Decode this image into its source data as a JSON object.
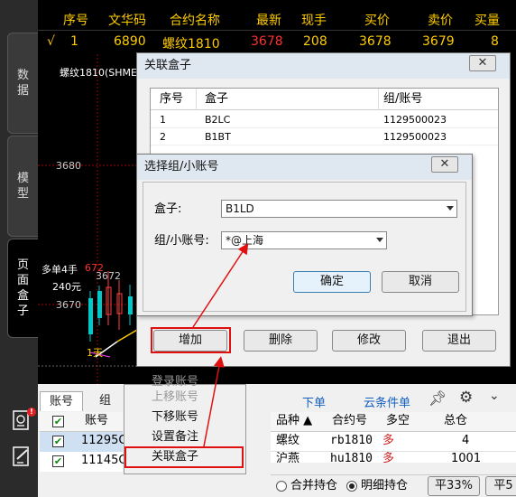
{
  "quote": {
    "headers": [
      "序号",
      "文华码",
      "合约名称",
      "最新",
      "现手",
      "买价",
      "卖价",
      "买量"
    ],
    "row": {
      "mark": "√",
      "index": "1",
      "code": "6890",
      "name": "螺纹1810",
      "last": "3678",
      "hand": "208",
      "bid": "3678",
      "ask": "3679",
      "bidvol": "8"
    }
  },
  "nav": {
    "tab1": [
      "数",
      "据"
    ],
    "tab2": [
      "模",
      "型"
    ],
    "tab3": [
      "页",
      "面",
      "盒",
      "子"
    ]
  },
  "chart": {
    "title": "螺纹1810(SHME",
    "price_3680": "3680",
    "price_3672": "3672",
    "price_3670": "3670",
    "signal": "多单4手",
    "signal_value": "672",
    "price_240": "240元",
    "day_label": "1天"
  },
  "bottom": {
    "tabs": [
      "账号",
      "组"
    ],
    "account_header": "账号",
    "accounts": [
      "11295C",
      "11145C"
    ],
    "toolbar": {
      "order": "下单",
      "cloud": "云条件单"
    },
    "positions_headers": [
      "品种 ▲",
      "合约号",
      "多空",
      "总仓"
    ],
    "positions": [
      {
        "product": "螺纹",
        "contract": "rb1810",
        "side": "多",
        "total": "4"
      },
      {
        "product": "沪燕",
        "contract": "hu1810",
        "side": "多",
        "total": "1001"
      }
    ],
    "radio_merge": "合并持仓",
    "radio_detail": "明细持仓",
    "btn_flat33": "平33%",
    "btn_flat5": "平5"
  },
  "ctxmenu": {
    "items": [
      "登录账号",
      "上移账号",
      "下移账号",
      "设置备注",
      "关联盒子"
    ]
  },
  "dlg_outer": {
    "title": "关联盒子",
    "close": "✕",
    "headers": [
      "序号",
      "盒子",
      "组/账号"
    ],
    "rows": [
      {
        "index": "1",
        "box": "B2LC",
        "account": "1129500023"
      },
      {
        "index": "2",
        "box": "B1BT",
        "account": "1129500023"
      }
    ],
    "btn_add": "增加",
    "btn_delete": "删除",
    "btn_modify": "修改",
    "btn_exit": "退出"
  },
  "dlg_inner": {
    "title": "选择组/小账号",
    "close": "✕",
    "box_label": "盒子:",
    "box_value": "B1LD",
    "group_label": "组/小账号:",
    "group_value": "*@上海",
    "btn_ok": "确定",
    "btn_cancel": "取消"
  },
  "colors": {
    "annotation_red": "#e01010",
    "quote_yellow": "#ffcc00",
    "quote_red": "#ff3030"
  }
}
